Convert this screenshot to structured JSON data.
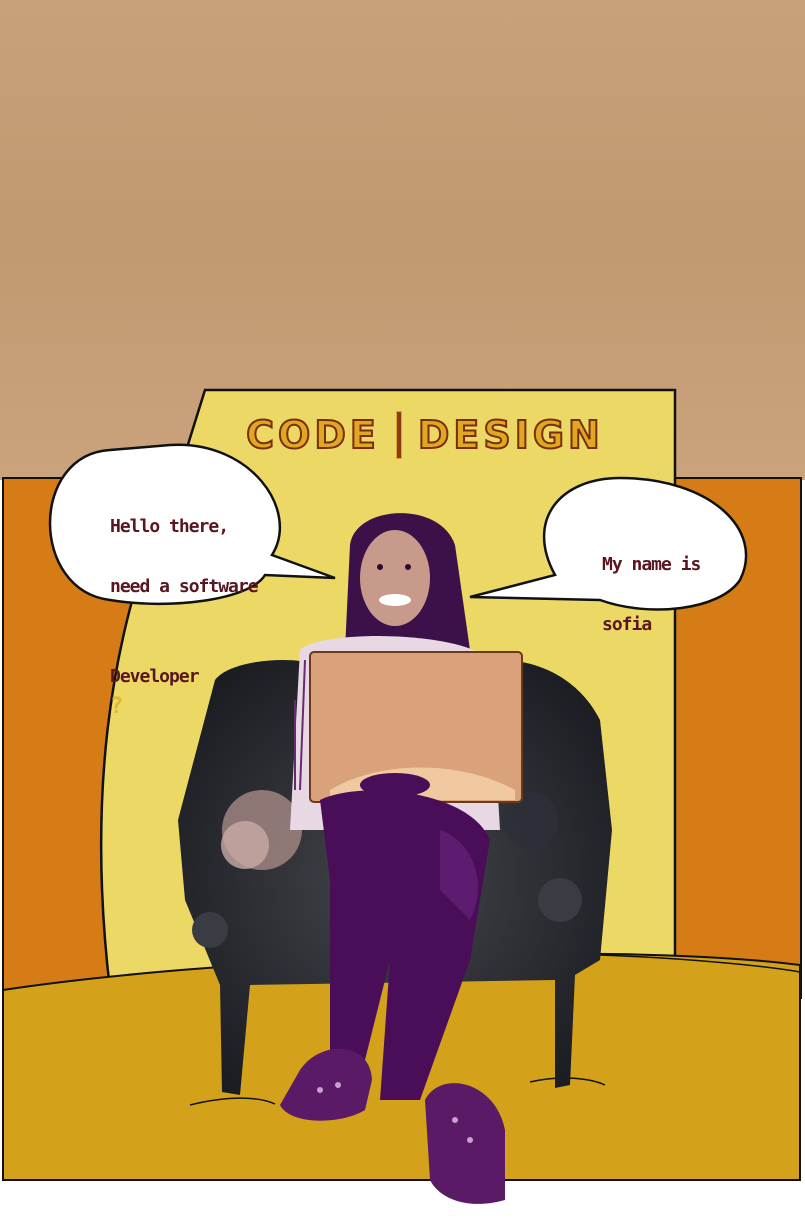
{
  "logo": {
    "left_word": "CODE",
    "right_word": "DESIGN"
  },
  "speech_left": {
    "line1": "Hello there,",
    "line2": "need a software",
    "line3": "Developer",
    "qmark": "?"
  },
  "speech_right": {
    "line1": "My name is",
    "line2": "sofia"
  },
  "colors": {
    "sky": "#c89e72",
    "orange_panel": "#d57c16",
    "yellow_panel": "#ecd965",
    "floor": "#d3a21a",
    "text": "#5a1620",
    "figure": "#4a0e58"
  },
  "illustration": {
    "subject": "person-sitting-in-armchair-with-laptop-icon"
  }
}
